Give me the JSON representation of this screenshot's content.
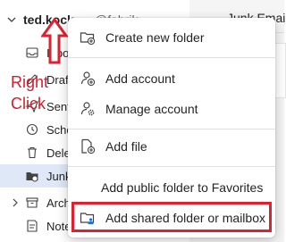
{
  "account": {
    "name": "ted.kock",
    "rest": "@fabrik"
  },
  "right_panel": {
    "title": "Junk Email"
  },
  "annotation": {
    "line1": "Right",
    "line2": "Click",
    "color": "#d41d2d"
  },
  "folders": [
    {
      "label": "Inbox",
      "icon": "inbox-icon"
    },
    {
      "label": "Drafts",
      "icon": "pencil-icon"
    },
    {
      "label": "Sent",
      "icon": "send-icon"
    },
    {
      "label": "Scheduled",
      "icon": "clock-icon"
    },
    {
      "label": "Deleted",
      "icon": "trash-icon"
    },
    {
      "label": "Junk",
      "icon": "junk-folder-icon"
    },
    {
      "label": "Archive",
      "icon": "archive-icon"
    },
    {
      "label": "Notes",
      "icon": "note-icon"
    }
  ],
  "menu": {
    "items": [
      {
        "label": "Create new folder",
        "icon": "new-folder-icon"
      },
      {
        "label": "Add account",
        "icon": "add-person-icon"
      },
      {
        "label": "Manage account",
        "icon": "person-gear-icon"
      },
      {
        "label": "Add file",
        "icon": "add-file-icon"
      },
      {
        "label": "Add public folder to Favorites",
        "icon": ""
      },
      {
        "label": "Add shared folder or mailbox",
        "icon": "shared-folder-icon"
      }
    ],
    "highlight_color": "#e0202e"
  }
}
